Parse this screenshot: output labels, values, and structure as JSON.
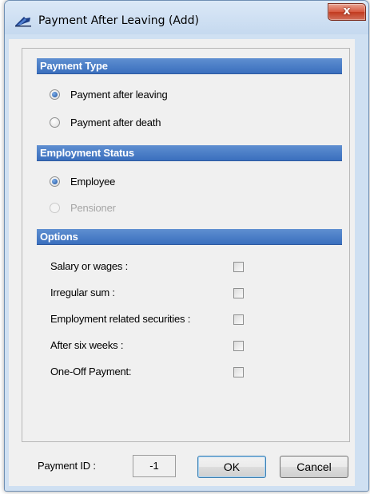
{
  "window": {
    "title": "Payment After Leaving (Add)",
    "close_glyph": "x"
  },
  "payment_type": {
    "header": "Payment Type",
    "options": [
      {
        "label": "Payment after leaving",
        "checked": true,
        "enabled": true
      },
      {
        "label": "Payment after death",
        "checked": false,
        "enabled": true
      }
    ]
  },
  "employment_status": {
    "header": "Employment Status",
    "options": [
      {
        "label": "Employee",
        "checked": true,
        "enabled": true
      },
      {
        "label": "Pensioner",
        "checked": false,
        "enabled": false
      }
    ]
  },
  "options": {
    "header": "Options",
    "items": [
      {
        "label": "Salary or wages :",
        "checked": false
      },
      {
        "label": "Irregular sum :",
        "checked": false
      },
      {
        "label": "Employment related securities :",
        "checked": false
      },
      {
        "label": "After six weeks :",
        "checked": false
      },
      {
        "label": "One-Off Payment:",
        "checked": false
      }
    ]
  },
  "footer": {
    "payment_id_label": "Payment ID :",
    "payment_id_value": "-1",
    "ok_label": "OK",
    "cancel_label": "Cancel"
  },
  "colors": {
    "section_header": "#3a6fbe",
    "window_frame": "#cfe0f2",
    "close_button": "#c23a1f"
  }
}
